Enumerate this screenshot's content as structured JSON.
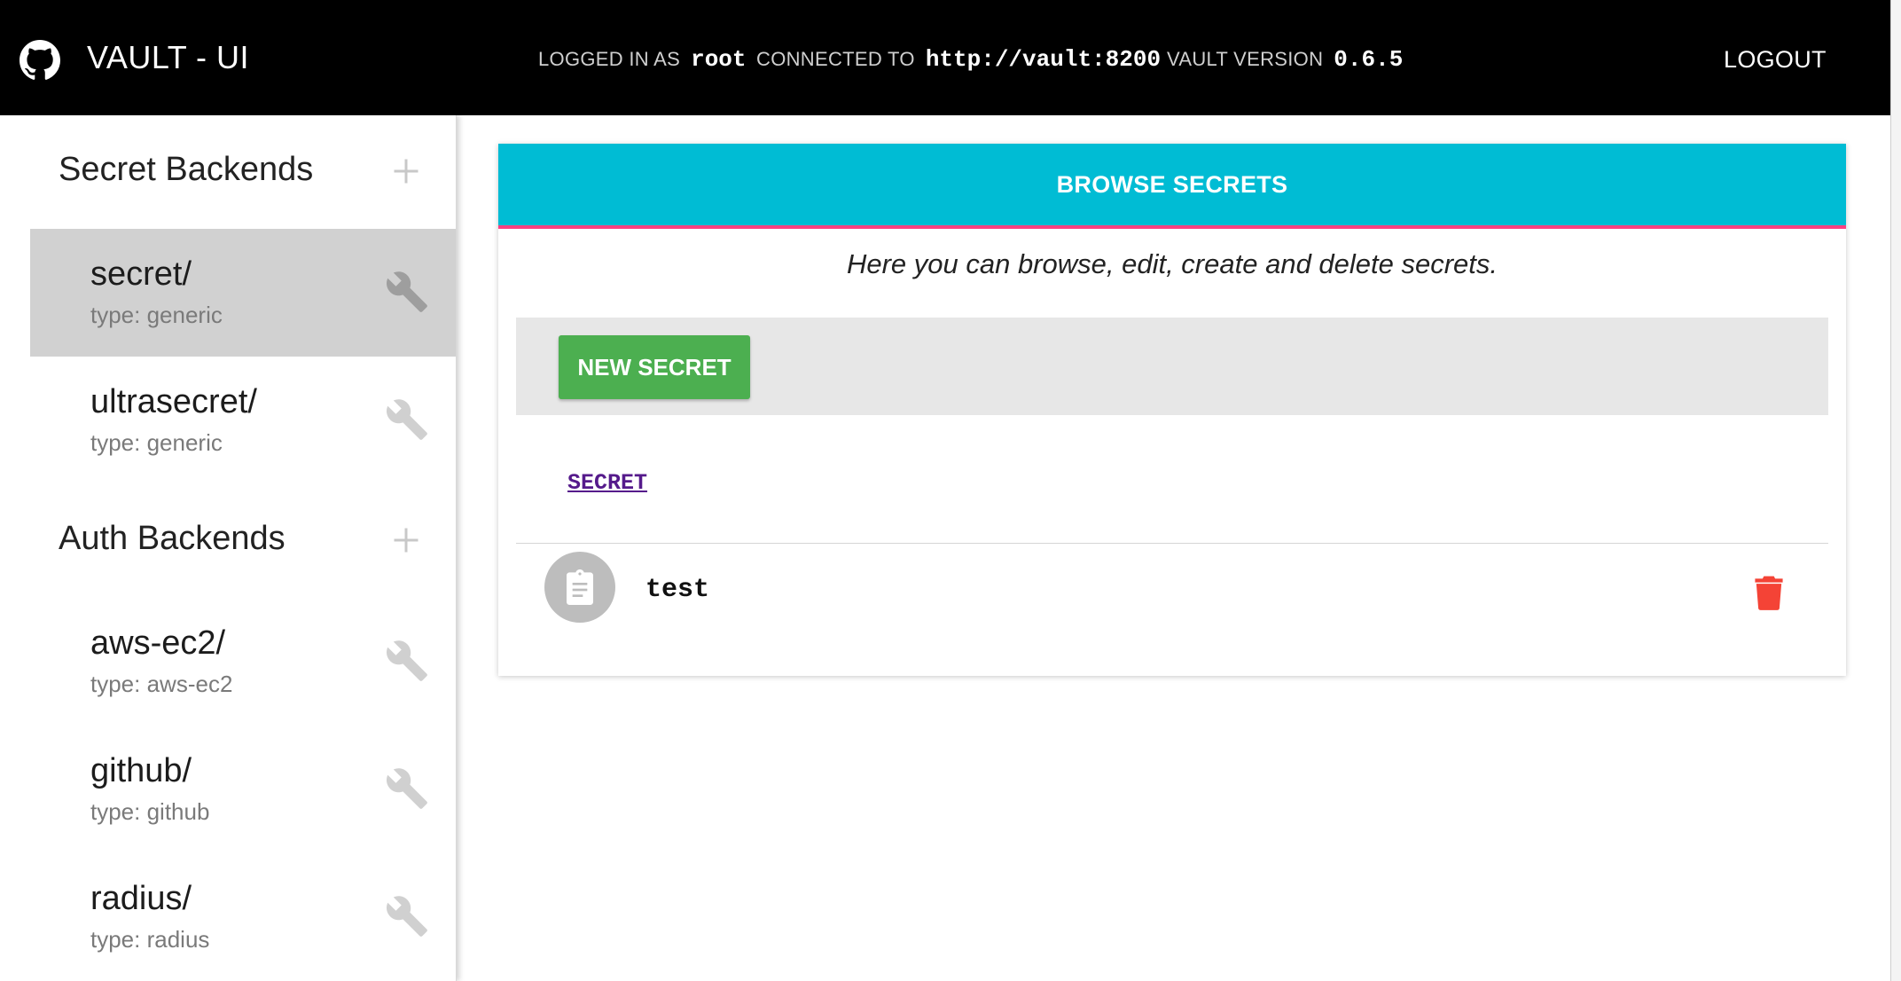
{
  "header": {
    "title": "VAULT - UI",
    "logged_in_label": "LOGGED IN AS",
    "logged_in_value": "root",
    "connected_label": "CONNECTED TO",
    "connected_value": "http://vault:8200",
    "version_label": "VAULT VERSION",
    "version_value": "0.6.5",
    "logout_label": "LOGOUT",
    "logo_icon": "github-icon"
  },
  "sidebar": {
    "secret_backends_header": "Secret Backends",
    "secret_backends": [
      {
        "name": "secret/",
        "type": "type: generic",
        "active": true
      },
      {
        "name": "ultrasecret/",
        "type": "type: generic",
        "active": false
      }
    ],
    "auth_backends_header": "Auth Backends",
    "auth_backends": [
      {
        "name": "aws-ec2/",
        "type": "type: aws-ec2"
      },
      {
        "name": "github/",
        "type": "type: github"
      },
      {
        "name": "radius/",
        "type": "type: radius"
      }
    ]
  },
  "main": {
    "header_title": "BROWSE SECRETS",
    "description": "Here you can browse, edit, create and delete secrets.",
    "new_secret_label": "NEW SECRET",
    "breadcrumb": "SECRET",
    "secrets": [
      {
        "name": "test",
        "icon": "clipboard-icon"
      }
    ]
  },
  "colors": {
    "header_bg": "#000000",
    "accent": "#00bcd4",
    "accent_border": "#ff4081",
    "primary_button": "#4caf50",
    "delete": "#f44336",
    "active_item": "#d1d1d1"
  }
}
